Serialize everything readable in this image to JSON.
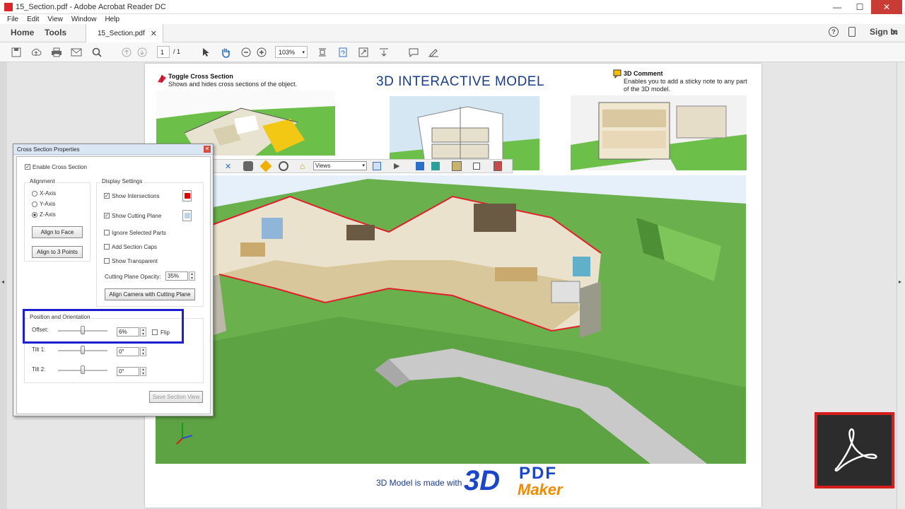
{
  "window": {
    "title": "15_Section.pdf - Adobe Acrobat Reader DC",
    "minimize": "—",
    "maximize": "☐",
    "close": "✕"
  },
  "menu": [
    "File",
    "Edit",
    "View",
    "Window",
    "Help"
  ],
  "tabs": {
    "home": "Home",
    "tools": "Tools",
    "doc": "15_Section.pdf",
    "close": "✕"
  },
  "header_right": {
    "help": "?",
    "signin": "Sign In",
    "close": "✕"
  },
  "toolbar": {
    "page_current": "1",
    "page_total": "/ 1",
    "zoom": "103%"
  },
  "document": {
    "title": "3D INTERACTIVE MODEL",
    "left_note": {
      "title": "Toggle Cross Section",
      "text": "Shows and hides cross sections of the object."
    },
    "right_note": {
      "title": "3D Comment",
      "text": "Enables you to add a sticky note to any part of the 3D model."
    },
    "footer": "3D Model is made with",
    "logo_3d": "3D",
    "logo_pdf": "PDF",
    "logo_maker": "Maker"
  },
  "toolbar3d": {
    "views": "Views"
  },
  "dialog": {
    "title": "Cross Section Properties",
    "enable": "Enable Cross Section",
    "alignment": {
      "heading": "Alignment",
      "x": "X-Axis",
      "y": "Y-Axis",
      "z": "Z-Axis",
      "align_face": "Align to Face",
      "align_3": "Align to 3 Points"
    },
    "display": {
      "heading": "Display Settings",
      "show_intersections": "Show Intersections",
      "show_cutting_plane": "Show Cutting Plane",
      "ignore_selected": "Ignore Selected Parts",
      "add_caps": "Add Section Caps",
      "show_transparent": "Show Transparent",
      "opacity_label": "Cutting Plane Opacity:",
      "opacity_value": "35%",
      "align_camera": "Align Camera with Cutting Plane"
    },
    "position": {
      "heading": "Position and Orientation",
      "offset_label": "Offset:",
      "offset_value": "6%",
      "offset_level": 0.5,
      "flip": "Flip",
      "tilt1_label": "Tilt 1:",
      "tilt1_value": "0°",
      "tilt2_label": "Tilt 2:",
      "tilt2_value": "0°"
    },
    "save_view": "Save Section View"
  },
  "colors": {
    "accent": "#1b1fd0",
    "title_blue": "#1a3c8c",
    "acrobat_red": "#d41e1e",
    "grass": "#6ab04c"
  }
}
